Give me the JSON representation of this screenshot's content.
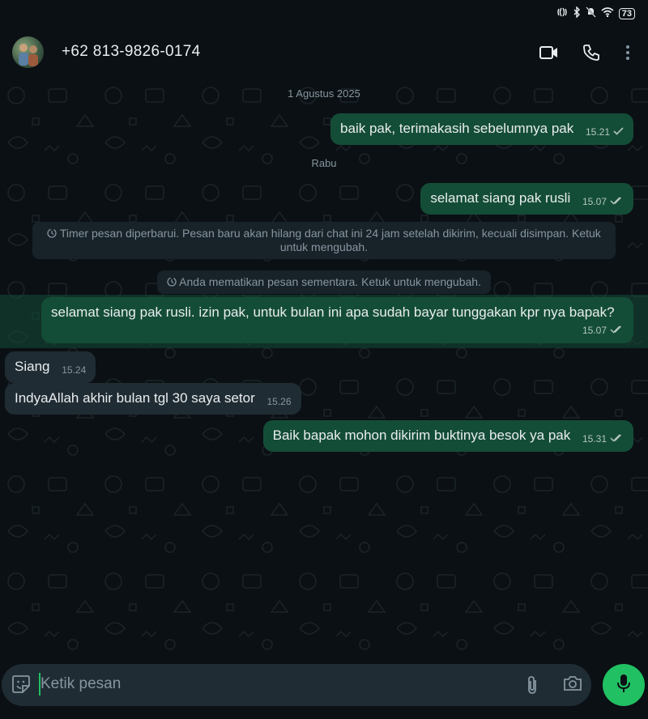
{
  "status_bar": {
    "battery": "73"
  },
  "header": {
    "contact_name": "+62 813-9826-0174",
    "icons": [
      "video-call-icon",
      "voice-call-icon",
      "more-options-icon"
    ]
  },
  "chat": {
    "date_chip_1": "1 Agustus 2025",
    "date_chip_2": "Rabu",
    "messages": [
      {
        "direction": "out",
        "text": "baik pak, terimakasih sebelumnya pak",
        "time": "15.21",
        "status": "single-tick"
      },
      {
        "direction": "out",
        "text": "selamat siang pak rusli",
        "time": "15.07",
        "status": "double-tick"
      },
      {
        "direction": "out",
        "text": "selamat siang pak rusli. izin pak, untuk bulan ini apa sudah bayar tunggakan kpr nya bapak?",
        "time": "15.07",
        "status": "double-tick"
      },
      {
        "direction": "in",
        "text": "Siang",
        "time": "15.24"
      },
      {
        "direction": "in",
        "text": "IndyaAllah akhir bulan tgl 30 saya setor",
        "time": "15.26"
      },
      {
        "direction": "out",
        "text": "Baik bapak mohon dikirim buktinya besok ya pak",
        "time": "15.31",
        "status": "double-tick"
      }
    ],
    "system_1": "Timer pesan diperbarui. Pesan baru akan hilang dari chat ini 24 jam setelah dikirim, kecuali disimpan. Ketuk untuk mengubah.",
    "system_2": "Anda mematikan pesan sementara. Ketuk untuk mengubah."
  },
  "composer": {
    "placeholder": "Ketik pesan",
    "icons": [
      "sticker-icon",
      "attach-icon",
      "camera-icon",
      "mic-icon"
    ]
  },
  "colors": {
    "outgoing_bubble": "#144d37",
    "incoming_bubble": "#202c33",
    "accent": "#21c063",
    "background": "#0b1014"
  }
}
